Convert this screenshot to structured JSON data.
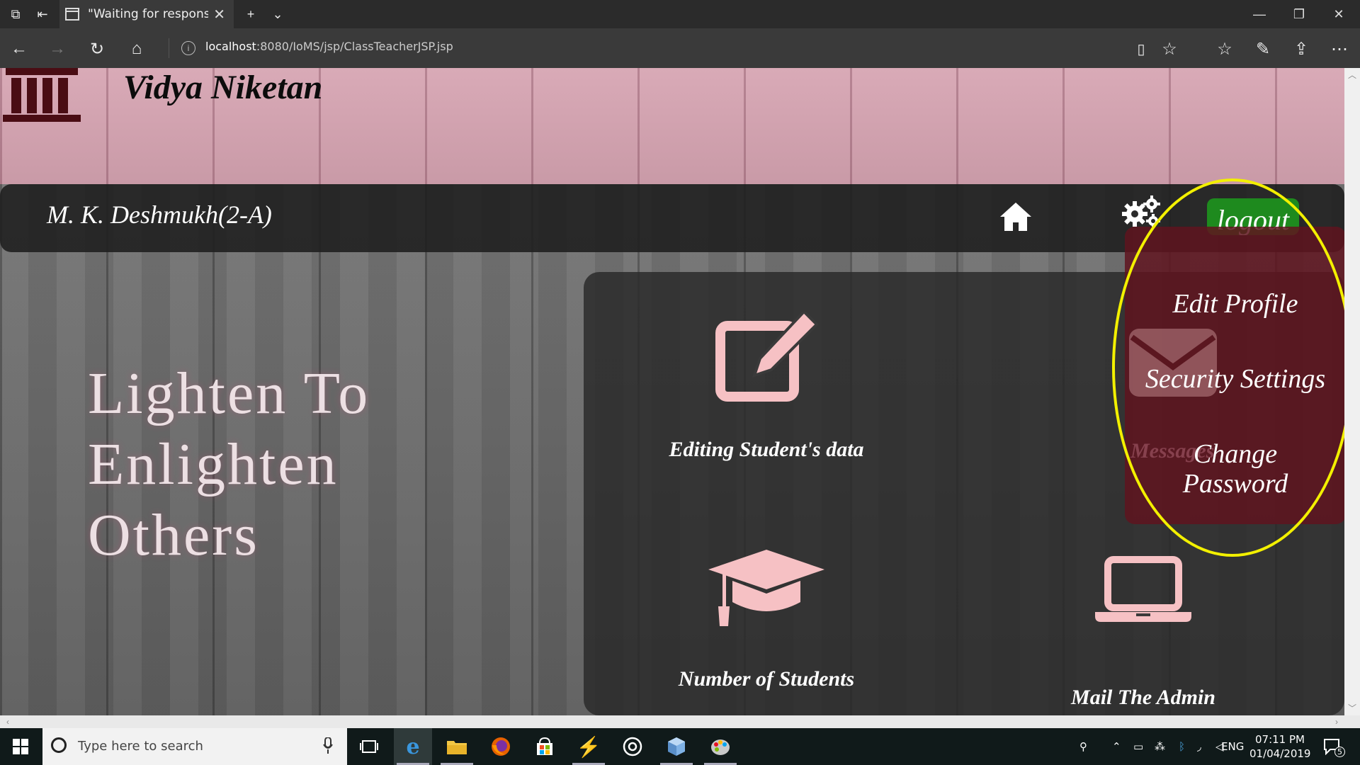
{
  "browser": {
    "tab_title": "\"Waiting for response fr",
    "url_host": "localhost",
    "url_path": ":8080/IoMS/jsp/ClassTeacherJSP.jsp"
  },
  "site": {
    "title": "Vidya Niketan",
    "teacher_name": "M. K. Deshmukh(2-A)",
    "logout_label": "logout",
    "tagline": [
      "Lighten To",
      "Enlighten",
      "Others"
    ]
  },
  "cards": [
    {
      "label": "Editing Student's data",
      "icon": "edit-icon"
    },
    {
      "label": "Number of Students",
      "icon": "graduation-cap-icon"
    },
    {
      "label": "Mail The Admin",
      "icon": "laptop-icon"
    },
    {
      "label": "Messages",
      "icon": "envelope-icon"
    }
  ],
  "settings_menu": {
    "items": [
      "Edit Profile",
      "Security Settings",
      "Change",
      "Password"
    ]
  },
  "colors": {
    "accent_pink": "#f6c1c4",
    "logout_green": "#1e8a1e",
    "dropdown_bg": "#5f141e",
    "highlight": "#f3f000"
  },
  "taskbar": {
    "search_placeholder": "Type here to search",
    "language": "ENG",
    "time": "07:11 PM",
    "date": "01/04/2019",
    "notifications": "5"
  }
}
